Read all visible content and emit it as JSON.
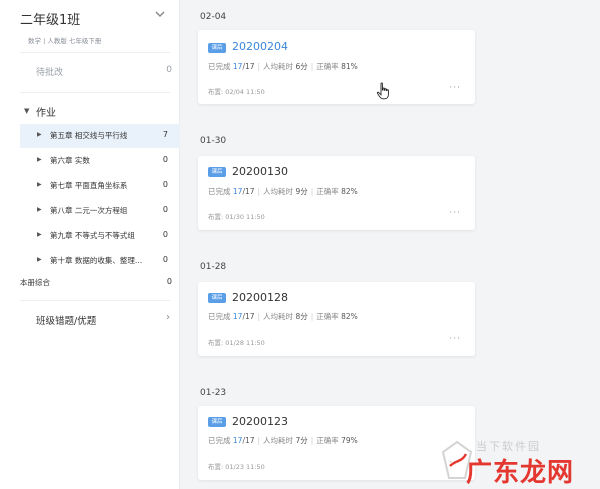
{
  "sidebar": {
    "class_title": "二年级1班",
    "class_subtitle": "数学 | 人教版 七年级下册",
    "pending": {
      "label": "待批改",
      "count": "0"
    },
    "homework_section": "作业",
    "chapters": [
      {
        "label": "第五章 相交线与平行线",
        "count": "7",
        "active": true
      },
      {
        "label": "第六章 实数",
        "count": "0"
      },
      {
        "label": "第七章 平面直角坐标系",
        "count": "0"
      },
      {
        "label": "第八章 二元一次方程组",
        "count": "0"
      },
      {
        "label": "第九章 不等式与不等式组",
        "count": "0"
      },
      {
        "label": "第十章 数据的收集、整理…",
        "count": "0"
      }
    ],
    "book_synthesis": {
      "label": "本册综合",
      "count": "0"
    },
    "wrong_questions": "班级错题/优题"
  },
  "groups": [
    {
      "date": "02-04",
      "card": {
        "badge": "课后",
        "title": "20200204",
        "done_label": "已完成",
        "done_value": "17",
        "done_total": "/17",
        "time_label": "人均耗时",
        "time_value": "6分",
        "accuracy_label": "正确率",
        "accuracy_value": "81%",
        "published": "布置: 02/04 11:50",
        "more": "···"
      }
    },
    {
      "date": "01-30",
      "card": {
        "badge": "课后",
        "title": "20200130",
        "done_label": "已完成",
        "done_value": "17",
        "done_total": "/17",
        "time_label": "人均耗时",
        "time_value": "9分",
        "accuracy_label": "正确率",
        "accuracy_value": "82%",
        "published": "布置: 01/30 11:50",
        "more": "···"
      }
    },
    {
      "date": "01-28",
      "card": {
        "badge": "课后",
        "title": "20200128",
        "done_label": "已完成",
        "done_value": "17",
        "done_total": "/17",
        "time_label": "人均耗时",
        "time_value": "8分",
        "accuracy_label": "正确率",
        "accuracy_value": "82%",
        "published": "布置: 01/28 11:50",
        "more": "···"
      }
    },
    {
      "date": "01-23",
      "card": {
        "badge": "课后",
        "title": "20200123",
        "done_label": "已完成",
        "done_value": "17",
        "done_total": "/17",
        "time_label": "人均耗时",
        "time_value": "7分",
        "accuracy_label": "正确率",
        "accuracy_value": "79%",
        "published": "布置: 01/23 11:50",
        "more": "···"
      }
    }
  ],
  "watermark": {
    "top": "当下软件园",
    "main": "广东龙网"
  },
  "colors": {
    "accent": "#3a86d9",
    "badge": "#5b9ee8",
    "active_bg": "#e9f2fb",
    "watermark_red": "#e2231a"
  }
}
